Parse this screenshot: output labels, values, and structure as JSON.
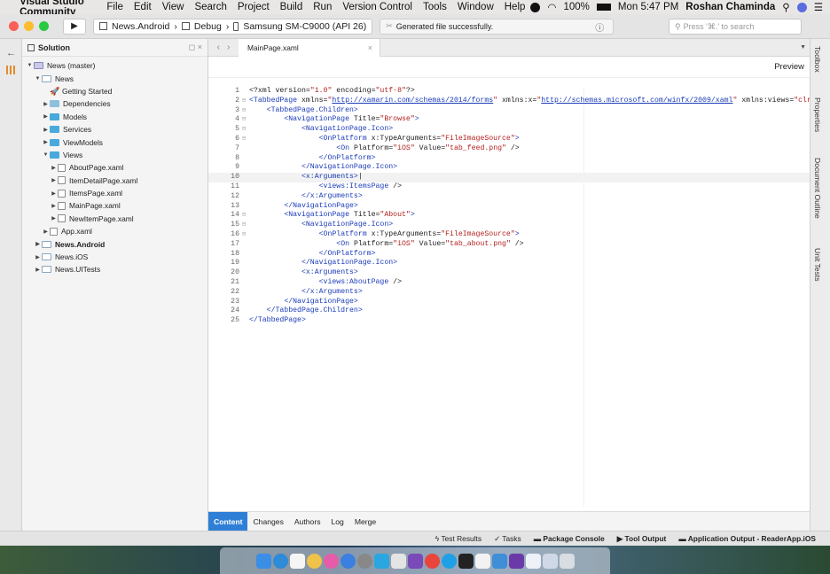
{
  "menubar": {
    "app_name": "Visual Studio Community",
    "items": [
      "File",
      "Edit",
      "View",
      "Search",
      "Project",
      "Build",
      "Run",
      "Version Control",
      "Tools",
      "Window",
      "Help"
    ],
    "battery": "100%",
    "clock": "Mon 5:47 PM",
    "user": "Roshan Chaminda"
  },
  "toolbar": {
    "project": "News.Android",
    "configuration": "Debug",
    "device": "Samsung SM-C9000 (API 26)",
    "status": "Generated file successfully.",
    "search_placeholder": "Press '⌘.' to search"
  },
  "solution": {
    "title": "Solution",
    "items": [
      {
        "label": "News (master)",
        "depth": 0,
        "arrow": "▼",
        "icon": "sol",
        "bold": false
      },
      {
        "label": "News",
        "depth": 1,
        "arrow": "▼",
        "icon": "proj",
        "bold": false
      },
      {
        "label": "Getting Started",
        "depth": 2,
        "arrow": "",
        "icon": "rocket",
        "bold": false
      },
      {
        "label": "Dependencies",
        "depth": 2,
        "arrow": "▶",
        "icon": "folderg",
        "bold": false
      },
      {
        "label": "Models",
        "depth": 2,
        "arrow": "▶",
        "icon": "folder",
        "bold": false
      },
      {
        "label": "Services",
        "depth": 2,
        "arrow": "▶",
        "icon": "folder",
        "bold": false
      },
      {
        "label": "ViewModels",
        "depth": 2,
        "arrow": "▶",
        "icon": "folder",
        "bold": false
      },
      {
        "label": "Views",
        "depth": 2,
        "arrow": "▼",
        "icon": "folder",
        "bold": false
      },
      {
        "label": "AboutPage.xaml",
        "depth": 3,
        "arrow": "▶",
        "icon": "xaml",
        "bold": false
      },
      {
        "label": "ItemDetailPage.xaml",
        "depth": 3,
        "arrow": "▶",
        "icon": "xaml",
        "bold": false
      },
      {
        "label": "ItemsPage.xaml",
        "depth": 3,
        "arrow": "▶",
        "icon": "xaml",
        "bold": false
      },
      {
        "label": "MainPage.xaml",
        "depth": 3,
        "arrow": "▶",
        "icon": "xaml",
        "bold": false
      },
      {
        "label": "NewItemPage.xaml",
        "depth": 3,
        "arrow": "▶",
        "icon": "xaml",
        "bold": false
      },
      {
        "label": "App.xaml",
        "depth": 2,
        "arrow": "▶",
        "icon": "xaml",
        "bold": false
      },
      {
        "label": "News.Android",
        "depth": 1,
        "arrow": "▶",
        "icon": "proj",
        "bold": true
      },
      {
        "label": "News.iOS",
        "depth": 1,
        "arrow": "▶",
        "icon": "proj",
        "bold": false
      },
      {
        "label": "News.UITests",
        "depth": 1,
        "arrow": "▶",
        "icon": "proj",
        "bold": false
      }
    ]
  },
  "editor": {
    "tab": "MainPage.xaml",
    "preview": "Preview",
    "lines": [
      [
        [
          "tx",
          "<?xml version="
        ],
        [
          "t-val",
          "\"1.0\""
        ],
        [
          "tx",
          " encoding="
        ],
        [
          "t-val",
          "\"utf-8\""
        ],
        [
          "tx",
          "?>"
        ]
      ],
      [
        [
          "t-tag",
          "<TabbedPage"
        ],
        [
          "tx",
          " xmlns="
        ],
        [
          "t-val",
          "\""
        ],
        [
          "t-url",
          "http://xamarin.com/schemas/2014/forms"
        ],
        [
          "t-val",
          "\""
        ],
        [
          "tx",
          " xmlns:x="
        ],
        [
          "t-val",
          "\""
        ],
        [
          "t-url",
          "http://schemas.microsoft.com/winfx/2009/xaml"
        ],
        [
          "t-val",
          "\""
        ],
        [
          "tx",
          " xmlns:views="
        ],
        [
          "t-val",
          "\"clr-nam"
        ]
      ],
      [
        [
          "tx",
          "    "
        ],
        [
          "t-tag",
          "<TabbedPage.Children>"
        ]
      ],
      [
        [
          "tx",
          "        "
        ],
        [
          "t-tag",
          "<NavigationPage"
        ],
        [
          "tx",
          " Title="
        ],
        [
          "t-val",
          "\"Browse\""
        ],
        [
          "t-tag",
          ">"
        ]
      ],
      [
        [
          "tx",
          "            "
        ],
        [
          "t-tag",
          "<NavigationPage.Icon>"
        ]
      ],
      [
        [
          "tx",
          "                "
        ],
        [
          "t-tag",
          "<OnPlatform"
        ],
        [
          "tx",
          " x:TypeArguments="
        ],
        [
          "t-val",
          "\"FileImageSource\""
        ],
        [
          "t-tag",
          ">"
        ]
      ],
      [
        [
          "tx",
          "                    "
        ],
        [
          "t-tag",
          "<On"
        ],
        [
          "tx",
          " Platform="
        ],
        [
          "t-val",
          "\"iOS\""
        ],
        [
          "tx",
          " Value="
        ],
        [
          "t-val",
          "\"tab_feed.png\""
        ],
        [
          "tx",
          " />"
        ]
      ],
      [
        [
          "tx",
          "                "
        ],
        [
          "t-tag",
          "</OnPlatform>"
        ]
      ],
      [
        [
          "tx",
          "            "
        ],
        [
          "t-tag",
          "</NavigationPage.Icon>"
        ]
      ],
      [
        [
          "tx",
          "            "
        ],
        [
          "t-tag",
          "<x:Arguments>"
        ],
        [
          "tx",
          "|"
        ]
      ],
      [
        [
          "tx",
          "                "
        ],
        [
          "t-tag",
          "<views:ItemsPage"
        ],
        [
          "tx",
          " />"
        ]
      ],
      [
        [
          "tx",
          "            "
        ],
        [
          "t-tag",
          "</x:Arguments>"
        ]
      ],
      [
        [
          "tx",
          "        "
        ],
        [
          "t-tag",
          "</NavigationPage>"
        ]
      ],
      [
        [
          "tx",
          "        "
        ],
        [
          "t-tag",
          "<NavigationPage"
        ],
        [
          "tx",
          " Title="
        ],
        [
          "t-val",
          "\"About\""
        ],
        [
          "t-tag",
          ">"
        ]
      ],
      [
        [
          "tx",
          "            "
        ],
        [
          "t-tag",
          "<NavigationPage.Icon>"
        ]
      ],
      [
        [
          "tx",
          "                "
        ],
        [
          "t-tag",
          "<OnPlatform"
        ],
        [
          "tx",
          " x:TypeArguments="
        ],
        [
          "t-val",
          "\"FileImageSource\""
        ],
        [
          "t-tag",
          ">"
        ]
      ],
      [
        [
          "tx",
          "                    "
        ],
        [
          "t-tag",
          "<On"
        ],
        [
          "tx",
          " Platform="
        ],
        [
          "t-val",
          "\"iOS\""
        ],
        [
          "tx",
          " Value="
        ],
        [
          "t-val",
          "\"tab_about.png\""
        ],
        [
          "tx",
          " />"
        ]
      ],
      [
        [
          "tx",
          "                "
        ],
        [
          "t-tag",
          "</OnPlatform>"
        ]
      ],
      [
        [
          "tx",
          "            "
        ],
        [
          "t-tag",
          "</NavigationPage.Icon>"
        ]
      ],
      [
        [
          "tx",
          "            "
        ],
        [
          "t-tag",
          "<x:Arguments>"
        ]
      ],
      [
        [
          "tx",
          "                "
        ],
        [
          "t-tag",
          "<views:AboutPage"
        ],
        [
          "tx",
          " />"
        ]
      ],
      [
        [
          "tx",
          "            "
        ],
        [
          "t-tag",
          "</x:Arguments>"
        ]
      ],
      [
        [
          "tx",
          "        "
        ],
        [
          "t-tag",
          "</NavigationPage>"
        ]
      ],
      [
        [
          "tx",
          "    "
        ],
        [
          "t-tag",
          "</TabbedPage.Children>"
        ]
      ],
      [
        [
          "t-tag",
          "</TabbedPage>"
        ]
      ]
    ],
    "bottom_tabs": [
      "Content",
      "Changes",
      "Authors",
      "Log",
      "Merge"
    ]
  },
  "right_panel": [
    "Toolbox",
    "Properties",
    "Document Outline",
    "Unit Tests"
  ],
  "statusbar": {
    "test_results": "Test Results",
    "tasks": "Tasks",
    "package_console": "Package Console",
    "tool_output": "Tool Output",
    "app_output": "Application Output - ReaderApp.iOS"
  },
  "colors": {
    "accent": "#2f7fd6",
    "tag": "#1a3bb8",
    "value": "#b0221f"
  }
}
